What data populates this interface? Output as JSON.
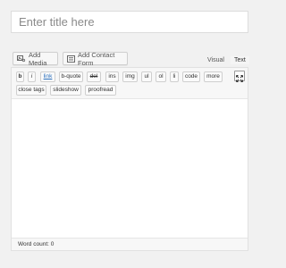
{
  "title_field": {
    "placeholder": "Enter title here"
  },
  "media_buttons": {
    "add_media": {
      "label": "Add Media",
      "icon": "add-media-icon"
    },
    "add_contact_form": {
      "label": "Add Contact Form",
      "icon": "contact-form-icon"
    }
  },
  "editor_tabs": [
    {
      "label": "Visual",
      "active": false
    },
    {
      "label": "Text",
      "active": true
    }
  ],
  "quicktags": [
    "b",
    "i",
    "link",
    "b-quote",
    "del",
    "ins",
    "img",
    "ul",
    "ol",
    "li",
    "code",
    "more",
    "close tags",
    "slideshow",
    "proofread"
  ],
  "fullscreen": {
    "icon": "fullscreen-icon"
  },
  "editor_content": "",
  "status": {
    "word_count": "Word count: 0"
  }
}
